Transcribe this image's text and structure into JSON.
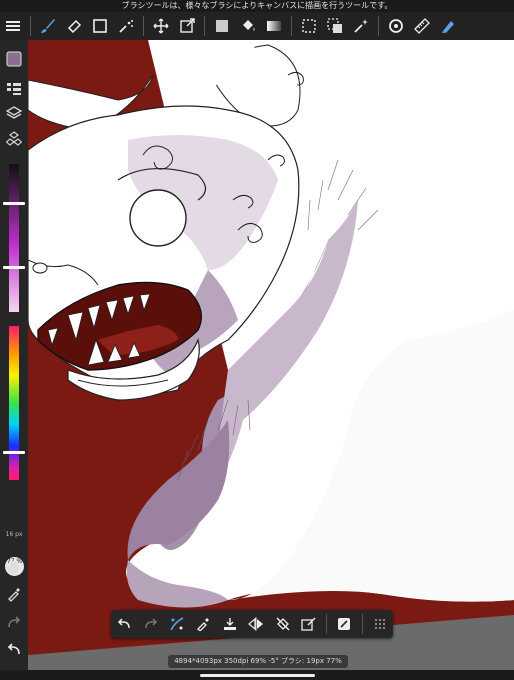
{
  "hint": "ブラシツールは、様々なブラシによりキャンバスに描画を行うツールです。",
  "toolbar": {
    "items": [
      "menu-icon",
      "brush-icon",
      "eraser-icon",
      "rectangle-icon",
      "magic-brush-icon",
      "move-icon",
      "transform-icon",
      "fill-color-icon",
      "bucket-icon",
      "gradient-icon",
      "select-rectangle-icon",
      "select-layer-icon",
      "magic-wand-icon",
      "rotate-canvas-icon",
      "ruler-icon",
      "pen-active-icon"
    ]
  },
  "sidebar": {
    "brush_size": "16 px",
    "zoom_text": "77 %"
  },
  "bottombar": {
    "items": [
      "undo-icon",
      "redo-icon",
      "stabilizer-icon",
      "eyedropper-icon",
      "layer-download-icon",
      "flip-icon",
      "snap-off-icon",
      "edit-layer-icon",
      "paste-icon",
      "grid-menu-icon"
    ]
  },
  "status": "4894*4093px 350dpi 69% -5° ブラシ: 19px 77%",
  "colors": {
    "background": "#7a1a12",
    "current_color": "#8a6f8f",
    "accent": "#5aa0e6"
  }
}
